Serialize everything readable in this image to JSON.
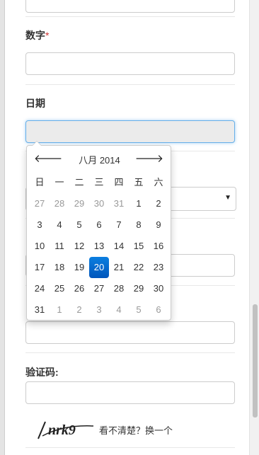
{
  "form": {
    "number_label": "数字",
    "required_mark": "*",
    "date_label": "日期",
    "captcha_label": "验证码:",
    "captcha_text": "nrk9",
    "captcha_refresh": "看不清楚？换一个"
  },
  "datepicker": {
    "title": "八月 2014",
    "prev_icon": "arrow-left-icon",
    "next_icon": "arrow-right-icon",
    "weekdays": [
      "日",
      "一",
      "二",
      "三",
      "四",
      "五",
      "六"
    ],
    "weeks": [
      [
        "27",
        "28",
        "29",
        "30",
        "31",
        "1",
        "2"
      ],
      [
        "3",
        "4",
        "5",
        "6",
        "7",
        "8",
        "9"
      ],
      [
        "10",
        "11",
        "12",
        "13",
        "14",
        "15",
        "16"
      ],
      [
        "17",
        "18",
        "19",
        "20",
        "21",
        "22",
        "23"
      ],
      [
        "24",
        "25",
        "26",
        "27",
        "28",
        "29",
        "30"
      ],
      [
        "31",
        "1",
        "2",
        "3",
        "4",
        "5",
        "6"
      ]
    ],
    "selected": "20",
    "active_color": "#0d6fd0"
  }
}
